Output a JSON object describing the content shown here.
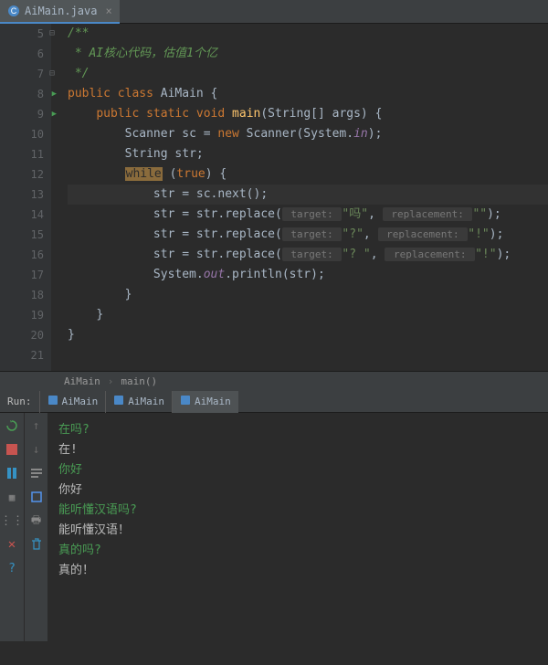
{
  "tab": {
    "filename": "AiMain.java"
  },
  "gutter": {
    "lines": [
      "5",
      "6",
      "7",
      "8",
      "9",
      "10",
      "11",
      "12",
      "13",
      "14",
      "15",
      "16",
      "17",
      "18",
      "19",
      "20",
      "21"
    ]
  },
  "code": {
    "l5": "/**",
    "l6_prefix": " * ",
    "l6_text": "AI核心代码，估值1个亿",
    "l7": " */",
    "l8_kw1": "public",
    "l8_kw2": "class",
    "l8_name": "AiMain",
    "l8_brace": " {",
    "l9_kw1": "public",
    "l9_kw2": "static",
    "l9_kw3": "void",
    "l9_method": "main",
    "l9_params": "(String[] args) {",
    "l10_pre": "Scanner sc = ",
    "l10_new": "new",
    "l10_post": " Scanner(System.",
    "l10_in": "in",
    "l10_end": ");",
    "l11": "String str;",
    "l12_while": "while",
    "l12_cond": " (",
    "l12_true": "true",
    "l12_end": ") {",
    "l13": "str = sc.next();",
    "l14_pre": "str = str.replace(",
    "l14_h1": " target: ",
    "l14_s1": "\"吗\"",
    "l14_c": ", ",
    "l14_h2": " replacement: ",
    "l14_s2": "\"\"",
    "l14_end": ");",
    "l15_pre": "str = str.replace(",
    "l15_h1": " target: ",
    "l15_s1": "\"?\"",
    "l15_c": ", ",
    "l15_h2": " replacement: ",
    "l15_s2": "\"!\"",
    "l15_end": ");",
    "l16_pre": "str = str.replace(",
    "l16_h1": " target: ",
    "l16_s1": "\"? \"",
    "l16_c": ", ",
    "l16_h2": " replacement: ",
    "l16_s2": "\"!\"",
    "l16_end": ");",
    "l17_pre": "System.",
    "l17_out": "out",
    "l17_post": ".println(str);",
    "l18": "}",
    "l19": "}",
    "l20": "}"
  },
  "breadcrumb": {
    "class": "AiMain",
    "method": "main()"
  },
  "run": {
    "label": "Run:",
    "tabs": [
      "AiMain",
      "AiMain",
      "AiMain"
    ]
  },
  "console": [
    {
      "type": "input",
      "text": "在吗?"
    },
    {
      "type": "output",
      "text": "在!"
    },
    {
      "type": "input",
      "text": "你好"
    },
    {
      "type": "output",
      "text": "你好"
    },
    {
      "type": "input",
      "text": "能听懂汉语吗?"
    },
    {
      "type": "output",
      "text": "能听懂汉语！"
    },
    {
      "type": "input",
      "text": "真的吗?"
    },
    {
      "type": "output",
      "text": "真的！"
    }
  ]
}
